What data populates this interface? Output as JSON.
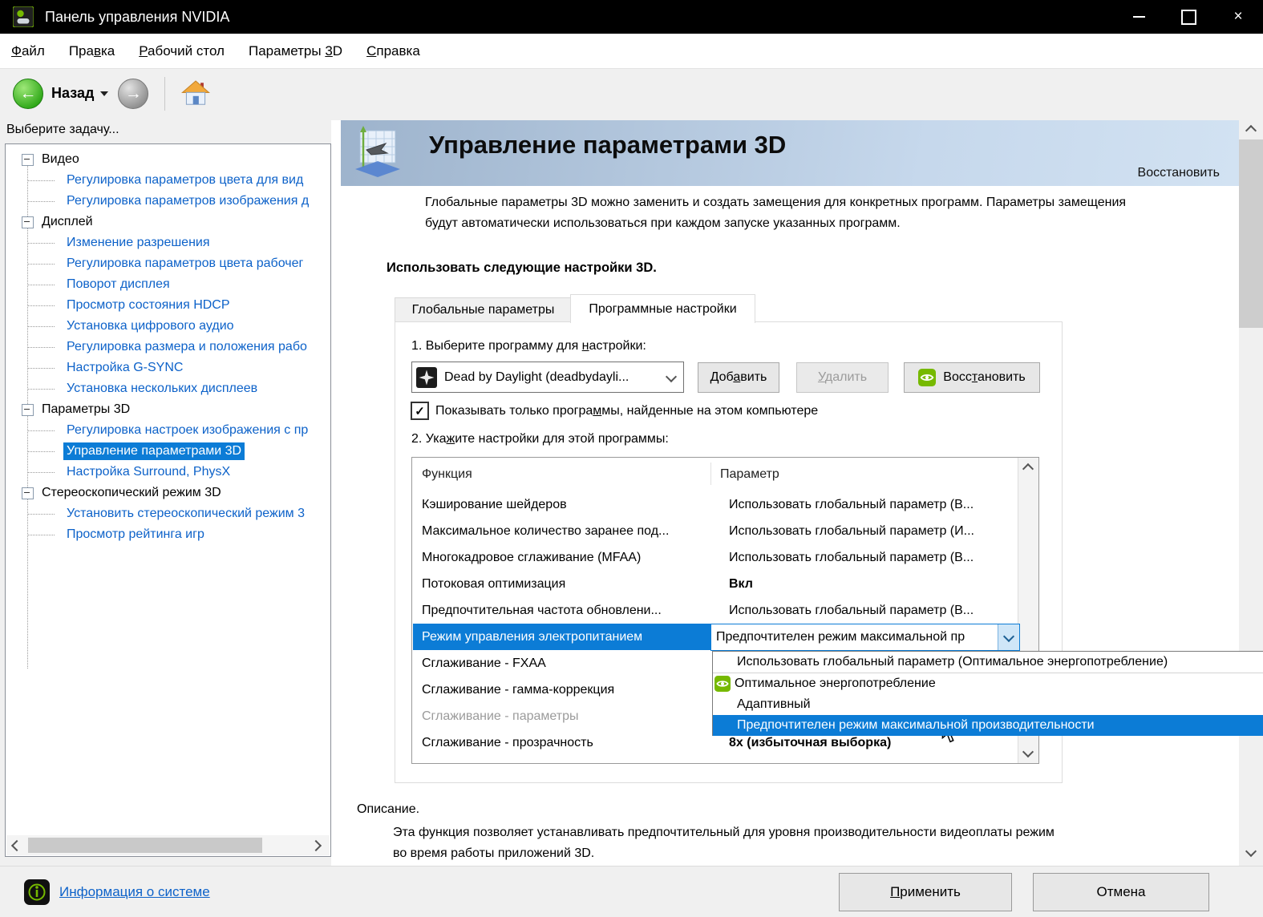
{
  "window": {
    "title": "Панель управления NVIDIA"
  },
  "icons": {
    "close": "×",
    "check": "✓",
    "back_arrow": "←",
    "forward_arrow": "→"
  },
  "menubar": {
    "items": [
      {
        "pre": "",
        "key": "Ф",
        "post": "айл"
      },
      {
        "pre": "Пра",
        "key": "в",
        "post": "ка"
      },
      {
        "pre": "",
        "key": "Р",
        "post": "абочий стол"
      },
      {
        "pre": "Параметры ",
        "key": "3",
        "post": "D"
      },
      {
        "pre": "",
        "key": "С",
        "post": "правка"
      }
    ]
  },
  "toolbar": {
    "back_label": "Назад"
  },
  "sidebar": {
    "header": "Выберите задачу...",
    "items": [
      {
        "label": "Видео"
      },
      {
        "label": "Регулировка параметров цвета для вид"
      },
      {
        "label": "Регулировка параметров изображения д"
      },
      {
        "label": "Дисплей"
      },
      {
        "label": "Изменение разрешения"
      },
      {
        "label": "Регулировка параметров цвета рабочег"
      },
      {
        "label": "Поворот дисплея"
      },
      {
        "label": "Просмотр состояния HDCP"
      },
      {
        "label": "Установка цифрового аудио"
      },
      {
        "label": "Регулировка размера и положения рабо"
      },
      {
        "label": "Настройка G-SYNC"
      },
      {
        "label": "Установка нескольких дисплеев"
      },
      {
        "label": "Параметры 3D"
      },
      {
        "label": "Регулировка настроек изображения с пр"
      },
      {
        "label": "Управление параметрами 3D"
      },
      {
        "label": "Настройка Surround, PhysX"
      },
      {
        "label": "Стереоскопический режим 3D"
      },
      {
        "label": "Установить стереоскопический режим 3"
      },
      {
        "label": "Просмотр рейтинга игр"
      }
    ]
  },
  "content": {
    "banner": {
      "title": "Управление параметрами 3D",
      "restore": "Восстановить"
    },
    "intro": {
      "line1": "Глобальные параметры 3D можно заменить и создать замещения для конкретных программ. Параметры замещения",
      "line2": "будут автоматически использоваться при каждом запуске указанных программ."
    },
    "heading": "Использовать следующие настройки 3D.",
    "tabs": {
      "global": "Глобальные параметры",
      "program": "Программные настройки"
    },
    "step1": {
      "pre": "1. Выберите программу для ",
      "key": "н",
      "post": "астройки:"
    },
    "program_combo": {
      "value": "Dead by Daylight (deadbydayli..."
    },
    "buttons": {
      "add": {
        "pre": "Доб",
        "key": "а",
        "post": "вить"
      },
      "remove": {
        "pre": "",
        "key": "У",
        "post": "далить"
      },
      "restore": {
        "pre": "Восс",
        "key": "т",
        "post": "ановить"
      }
    },
    "checkbox": {
      "pre": "Показывать только програ",
      "key": "м",
      "post": "мы, найденные на этом компьютере"
    },
    "step2": {
      "pre": "2. Ука",
      "key": "ж",
      "post": "ите настройки для этой программы:"
    },
    "table": {
      "col_function": "Функция",
      "col_param": "Параметр",
      "rows": [
        {
          "f": "Кэширование шейдеров",
          "p": "Использовать глобальный параметр (В..."
        },
        {
          "f": "Максимальное количество заранее под...",
          "p": "Использовать глобальный параметр (И..."
        },
        {
          "f": "Многокадровое сглаживание (MFAA)",
          "p": "Использовать глобальный параметр (В..."
        },
        {
          "f": "Потоковая оптимизация",
          "p": "Вкл"
        },
        {
          "f": "Предпочтительная частота обновлени...",
          "p": "Использовать глобальный параметр (В..."
        },
        {
          "f": "Режим управления электропитанием",
          "p": "Предпочтителен режим максимальной пр"
        },
        {
          "f": "Сглаживание - FXAA",
          "p": ""
        },
        {
          "f": "Сглаживание - гамма-коррекция",
          "p": ""
        },
        {
          "f": "Сглаживание - параметры",
          "p": ""
        },
        {
          "f": "Сглаживание - прозрачность",
          "p": "8x (избыточная выборка)"
        }
      ]
    },
    "dropdown": {
      "options": [
        "Использовать глобальный параметр (Оптимальное энергопотребление)",
        "Оптимальное энергопотребление",
        "Адаптивный",
        "Предпочтителен режим максимальной производительности"
      ]
    },
    "description": {
      "title": "Описание.",
      "line1": "Эта функция позволяет устанавливать предпочтительный для уровня производительности видеоплаты режим",
      "line2": "во время работы приложений 3D."
    }
  },
  "footer": {
    "system_info": "Информация о системе",
    "apply": {
      "pre": "",
      "key": "П",
      "post": "рименить"
    },
    "cancel": "Отмена"
  }
}
